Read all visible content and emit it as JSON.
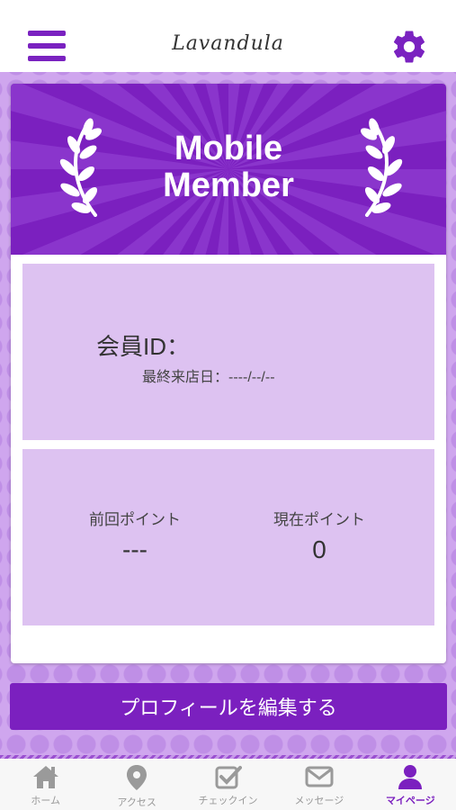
{
  "header": {
    "logo_text": "Lavandula"
  },
  "banner": {
    "title_line1": "Mobile",
    "title_line2": "Member"
  },
  "member": {
    "id_label": "会員ID：",
    "last_visit": "最終来店日：----/--/--"
  },
  "points": {
    "previous_label": "前回ポイント",
    "previous_value": "---",
    "current_label": "現在ポイント",
    "current_value": "0"
  },
  "edit_button": {
    "label": "プロフィールを編集する"
  },
  "bottom_nav": {
    "items": [
      {
        "label": "ホーム",
        "icon": "home-icon"
      },
      {
        "label": "アクセス",
        "icon": "map-pin-icon"
      },
      {
        "label": "チェックイン",
        "icon": "checkin-icon"
      },
      {
        "label": "メッセージ",
        "icon": "envelope-icon"
      },
      {
        "label": "マイページ",
        "icon": "user-icon"
      }
    ],
    "active_index": 4
  },
  "colors": {
    "accent": "#7b20bf",
    "panel": "#ddc2f1",
    "background": "#cfa6ee",
    "inactive_icon": "#9a9a9a"
  }
}
